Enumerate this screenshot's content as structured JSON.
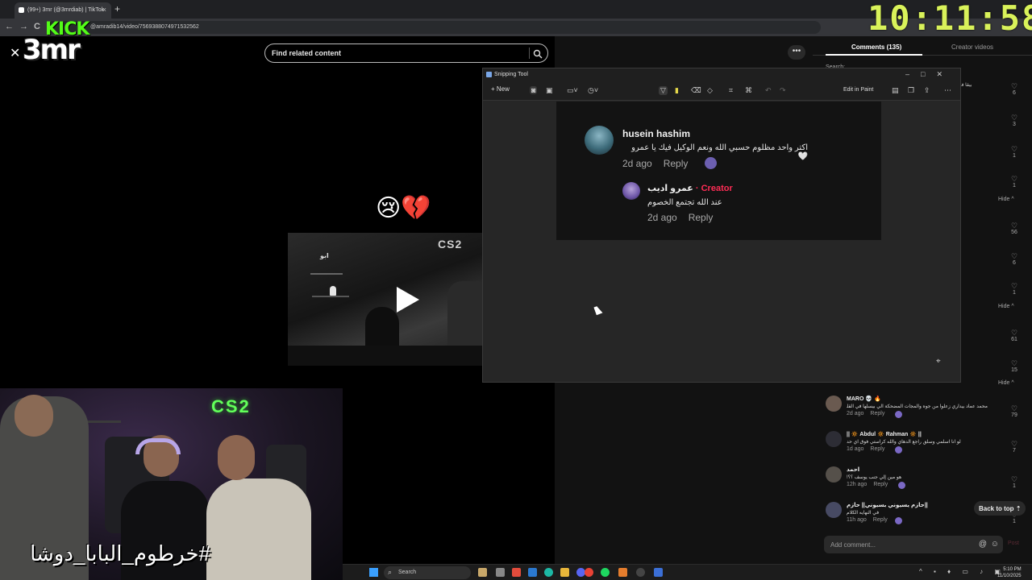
{
  "browser": {
    "tab_title": "(99+) 3mr (@3mrdiab) | TikTok",
    "tab_close": "×",
    "new_tab": "+",
    "url": "@amradib14/video/7569388074971532562",
    "back": "←",
    "forward": "→",
    "reload": "C"
  },
  "overlay": {
    "logo_top": "KICK",
    "logo_bottom": "3mr",
    "clock": "10:11:58",
    "hashtag": "#خرطوم_البابا_دوشا",
    "neon_sign": "CS2"
  },
  "player": {
    "close": "✕",
    "search_placeholder": "Find related content",
    "emojis": "😢💔",
    "thumb_brand": "CS2",
    "thumb_caption": "ابو",
    "more": "•••"
  },
  "snipping_tool": {
    "title": "Snipping Tool",
    "window_buttons": "–□✕",
    "new_label": "+  New",
    "edit_in_paint": "Edit in Paint",
    "corner_icon": "⌖"
  },
  "captured_comment": {
    "author": "husein hashim",
    "text": "اكتر واحد مظلوم حسبي الله ونعم الوكيل فيك يا عمرو🤍",
    "age": "2d ago",
    "reply": "Reply",
    "reply_author": "عمرو اديب",
    "creator_label": "· Creator",
    "reply_text": "عند الله تجتمع الخصوم",
    "reply_age": "2d ago",
    "reply_reply": "Reply"
  },
  "comments_panel": {
    "tab_comments": "Comments (135)",
    "tab_creator": "Creator videos",
    "related_search": "Search: ",
    "top_snippet": "بيقا فا كان",
    "likes": [
      {
        "count": "6"
      },
      {
        "count": "3"
      },
      {
        "count": "1"
      },
      {
        "count": "1"
      },
      {
        "count": "56"
      },
      {
        "count": "6"
      },
      {
        "count": "1"
      },
      {
        "count": "61"
      },
      {
        "count": "15"
      }
    ],
    "hide_label": "Hide ^",
    "comments": [
      {
        "name": "MARO 💀 🔥",
        "text": "محمد عماد بيداري زعلوا من جوه والمجات المضحكة الي بيسلها في القلب 💔",
        "age": "2d ago",
        "reply": "Reply",
        "likes": "79"
      },
      {
        "name": "|| 🔅 Abdul 🔅 Rahman 🔅 ||",
        "text": "لو انا اسلمي وسلق راجع الدهاي والله كراستي فوق اي حد",
        "age": "1d ago",
        "reply": "Reply",
        "likes": "7"
      },
      {
        "name": "احمد",
        "text": "هو مين إلي جنب يوسف ؟؟!",
        "age": "12h ago",
        "reply": "Reply",
        "likes": "1"
      },
      {
        "name": "حازم يسيوني بسيوني|| حازم||",
        "text": "في النهايه الكلام",
        "age": "11h ago",
        "reply": "Reply",
        "likes": "1"
      }
    ],
    "back_to_top": "Back to top ⇡",
    "add_comment_placeholder": "Add comment...",
    "at_icon": "@",
    "emoji_icon": "☺",
    "post": "Post"
  },
  "taskbar": {
    "search": "Search",
    "time": "5:10 PM",
    "date": "11/10/2025",
    "tray": "^ ▪ ♦ ▭ ♪ ▣"
  },
  "colors": {
    "accent_creator": "#fe2c55",
    "kick_green": "#53fc18",
    "clock_yellow": "#d9f25a"
  }
}
